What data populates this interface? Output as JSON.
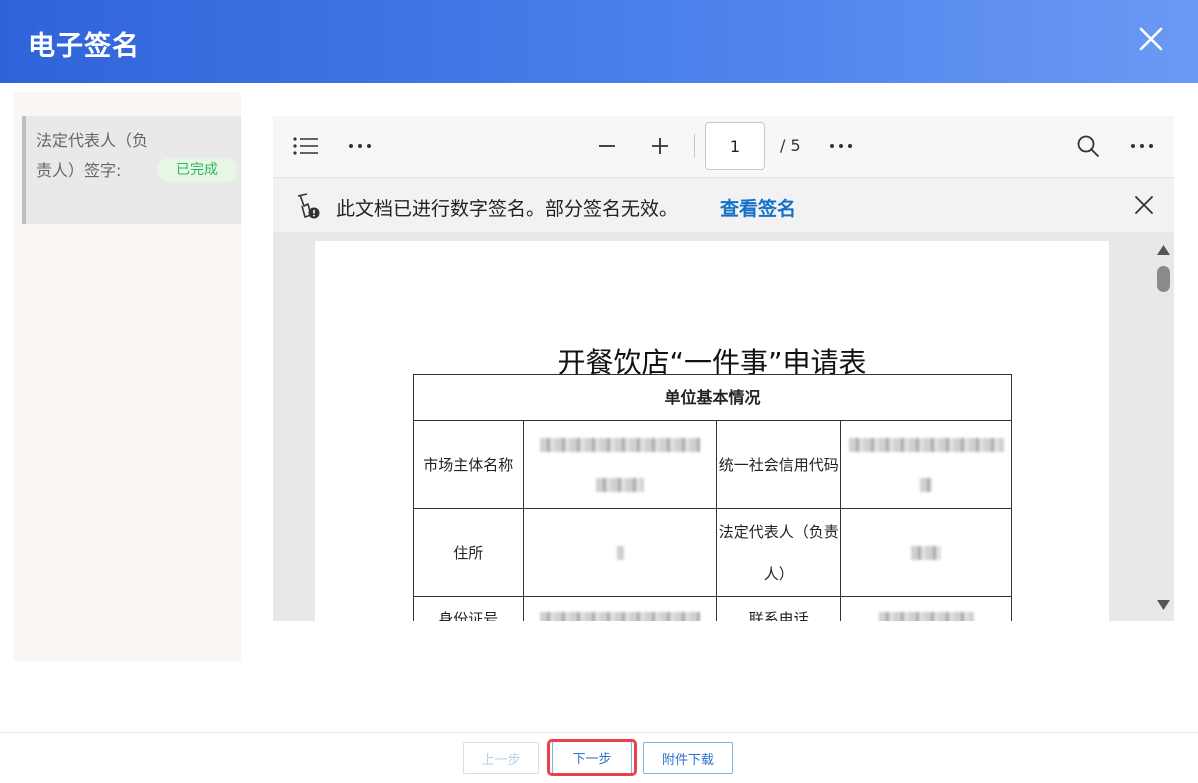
{
  "dialog": {
    "title": "电子签名",
    "close_icon": "close-icon"
  },
  "sidebar": {
    "items": [
      {
        "label": "法定代表人（负责人）签字:",
        "status": "已完成",
        "status_color": "#30b35f"
      }
    ]
  },
  "viewer": {
    "toolbar": {
      "page_number": "1",
      "page_total": "/ 5",
      "icons": [
        "list-icon",
        "more-icon",
        "zoom-out-icon",
        "zoom-in-icon",
        "more-icon",
        "search-icon",
        "more-icon"
      ]
    },
    "signature_banner": {
      "text": "此文档已进行数字签名。部分签名无效。",
      "link": "查看签名"
    },
    "document": {
      "title": "开餐饮店“一件事”申请表",
      "section_header": "单位基本情况",
      "rows": [
        {
          "label1": "市场主体名称",
          "label2": "统一社会信用代码"
        },
        {
          "label1": "住所",
          "label2": "法定代表人（负责人）"
        },
        {
          "label1": "身份证号",
          "label2": "联系电话"
        }
      ]
    }
  },
  "footer": {
    "prev_label": "上一步",
    "next_label": "下一步",
    "download_label": "附件下载",
    "accent_color": "#2a73cc",
    "focus_color": "#e8424f"
  }
}
